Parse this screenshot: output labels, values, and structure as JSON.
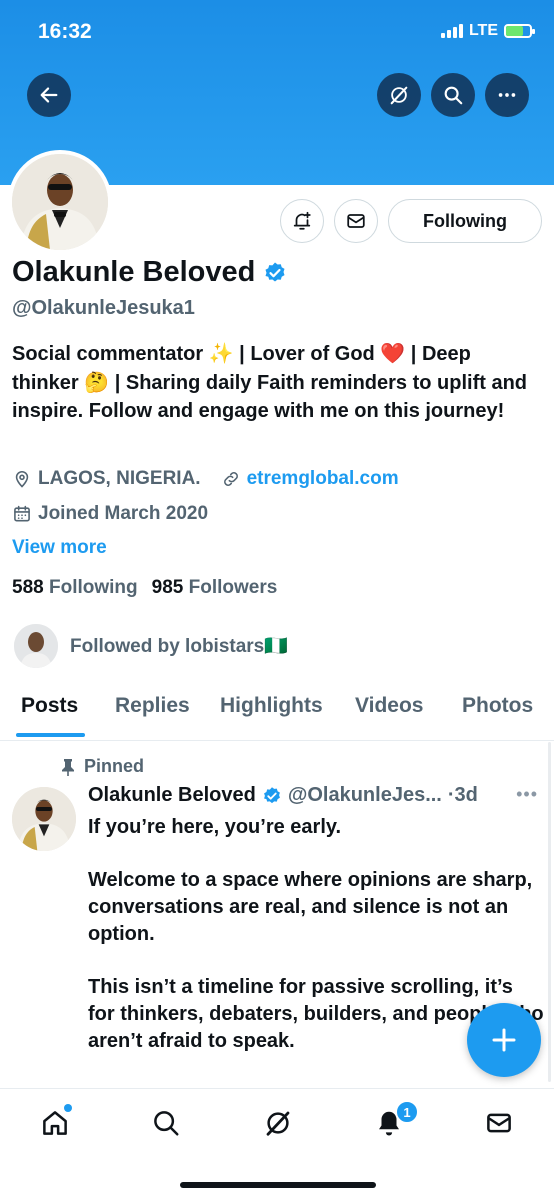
{
  "status": {
    "time": "16:32",
    "network": "LTE"
  },
  "profile": {
    "name": "Olakunle Beloved",
    "handle": "@OlakunleJesuka1",
    "bio": "Social commentator ✨ | Lover of God ❤️ | Deep thinker 🤔 | Sharing daily Faith reminders to uplift and inspire. Follow and engage with me on this journey!",
    "location": "LAGOS, NIGERIA.",
    "website": "etremglobal.com",
    "joined": "Joined March 2020",
    "view_more": "View more",
    "following_count": "588",
    "following_label": "Following",
    "followers_count": "985",
    "followers_label": "Followers",
    "followed_by": "Followed by lobistars🇳🇬"
  },
  "actions": {
    "follow_state": "Following"
  },
  "tabs": [
    {
      "label": "Posts"
    },
    {
      "label": "Replies"
    },
    {
      "label": "Highlights"
    },
    {
      "label": "Videos"
    },
    {
      "label": "Photos"
    }
  ],
  "pinned_post": {
    "pinned_label": "Pinned",
    "author": "Olakunle Beloved",
    "handle": "@OlakunleJes...",
    "time": "·3d",
    "paragraphs": [
      "If you’re here, you’re early.",
      "Welcome to a space where opinions are sharp, conversations are real, and silence is not an option.",
      "This isn’t a timeline for passive scrolling, it’s for thinkers, debaters, builders, and people who aren’t afraid to speak."
    ]
  },
  "bottom_nav": {
    "notifications_badge": "1"
  },
  "icons": [
    "back-arrow-icon",
    "grok-icon",
    "search-icon",
    "more-icon",
    "add-alert-icon",
    "message-icon",
    "location-icon",
    "link-icon",
    "calendar-icon",
    "pin-icon",
    "verified-icon",
    "compose-plus-icon",
    "home-icon",
    "notifications-icon",
    "mail-icon"
  ],
  "colors": {
    "accent": "#1d9bf0",
    "banner": "#2aa0f0",
    "text": "#0f1419",
    "secondary": "#536471"
  }
}
